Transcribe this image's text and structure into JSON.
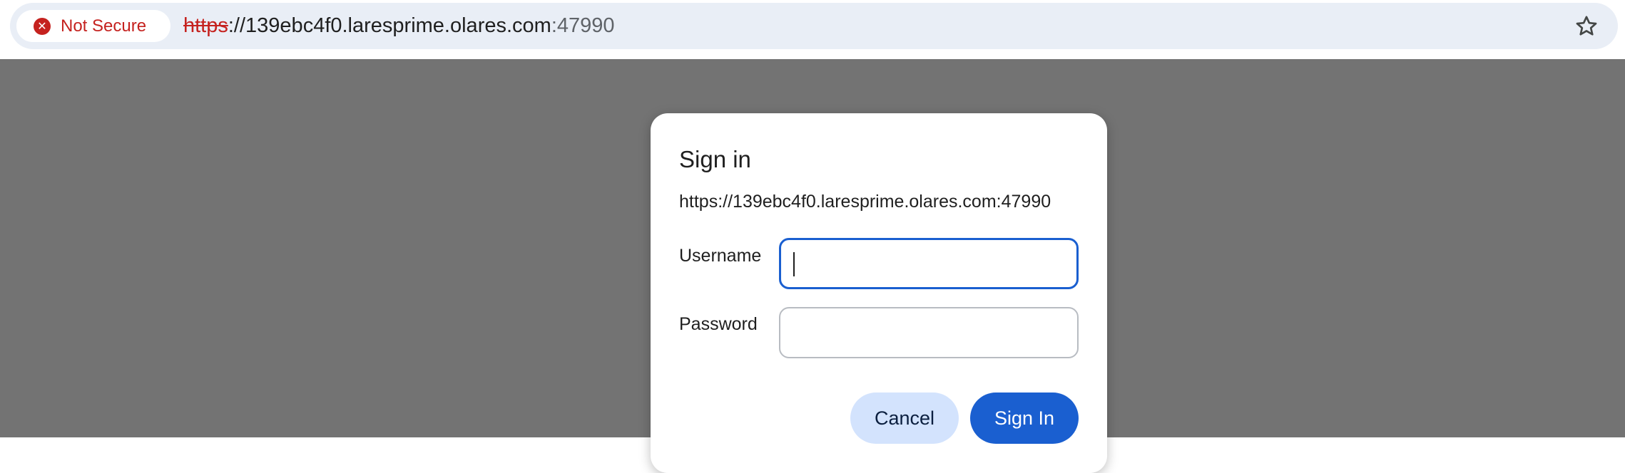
{
  "browser": {
    "security_chip": {
      "icon": "warning-circle-icon",
      "label": "Not Secure",
      "color": "#c5221f"
    },
    "url": {
      "scheme": "https",
      "separator": "://",
      "host": "139ebc4f0.laresprime.olares.com",
      "port": ":47990"
    },
    "bookmark_icon": "star-outline-icon"
  },
  "dialog": {
    "title": "Sign in",
    "origin": "https://139ebc4f0.laresprime.olares.com:47990",
    "username": {
      "label": "Username",
      "value": "",
      "focused": true
    },
    "password": {
      "label": "Password",
      "value": ""
    },
    "cancel_label": "Cancel",
    "signin_label": "Sign In",
    "accent_color": "#1a5fd0",
    "cancel_bg_color": "#d3e3fd"
  },
  "page": {
    "overlay_color": "#737373"
  }
}
